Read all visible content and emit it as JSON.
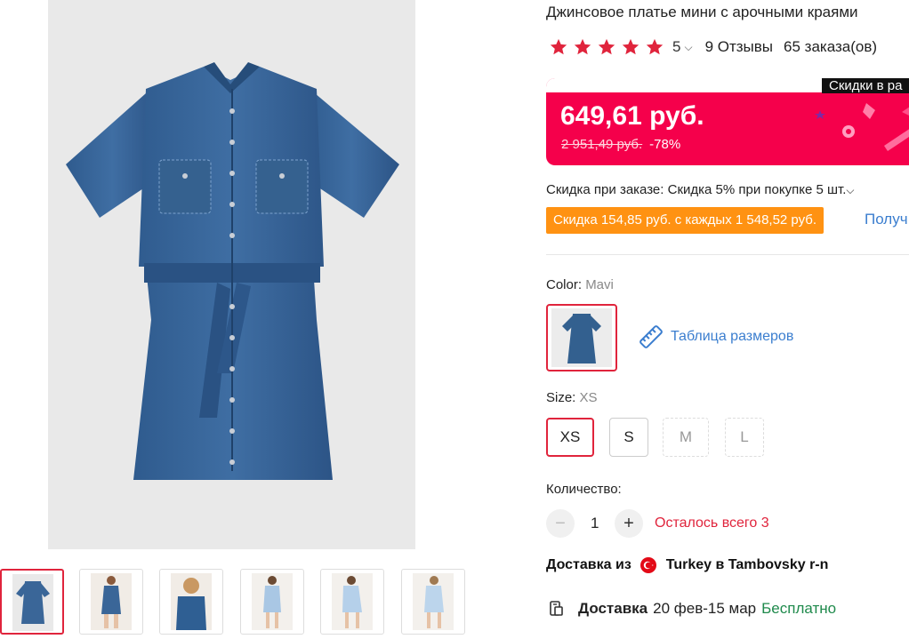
{
  "product": {
    "title": "Джинсовое платье мини с арочными краями",
    "rating": "5",
    "reviews": "9 Отзывы",
    "orders": "65 заказа(ов)"
  },
  "price": {
    "strip_label": "Скидки в ра",
    "current": "649,61 руб.",
    "old": "2 951,49 руб.",
    "discount": "-78%"
  },
  "promo": {
    "discount_line": "Скидка при заказе: Скидка 5% при покупке 5 шт.",
    "chip": "Скидка 154,85 руб. с каждых 1 548,52 руб.",
    "get_link": "Получ"
  },
  "color": {
    "label": "Color: ",
    "value": "Mavi"
  },
  "size_table": "Таблица размеров",
  "size": {
    "label": "Size: ",
    "value": "XS",
    "options": [
      "XS",
      "S",
      "M",
      "L"
    ]
  },
  "quantity": {
    "label": "Количество:",
    "value": "1",
    "minus": "−",
    "plus": "+",
    "stock": "Осталось всего 3"
  },
  "shipping": {
    "from_label": "Доставка из",
    "route": "Turkey в Tambovsky r-n"
  },
  "delivery": {
    "label": "Доставка",
    "dates": "20 фев-15 мар",
    "cost": "Бесплатно"
  },
  "colors": {
    "accent": "#e0243c",
    "price_bg": "#f5004b",
    "chip_bg": "#ff9212",
    "link": "#3b7ecf",
    "free": "#1f8a4c"
  }
}
